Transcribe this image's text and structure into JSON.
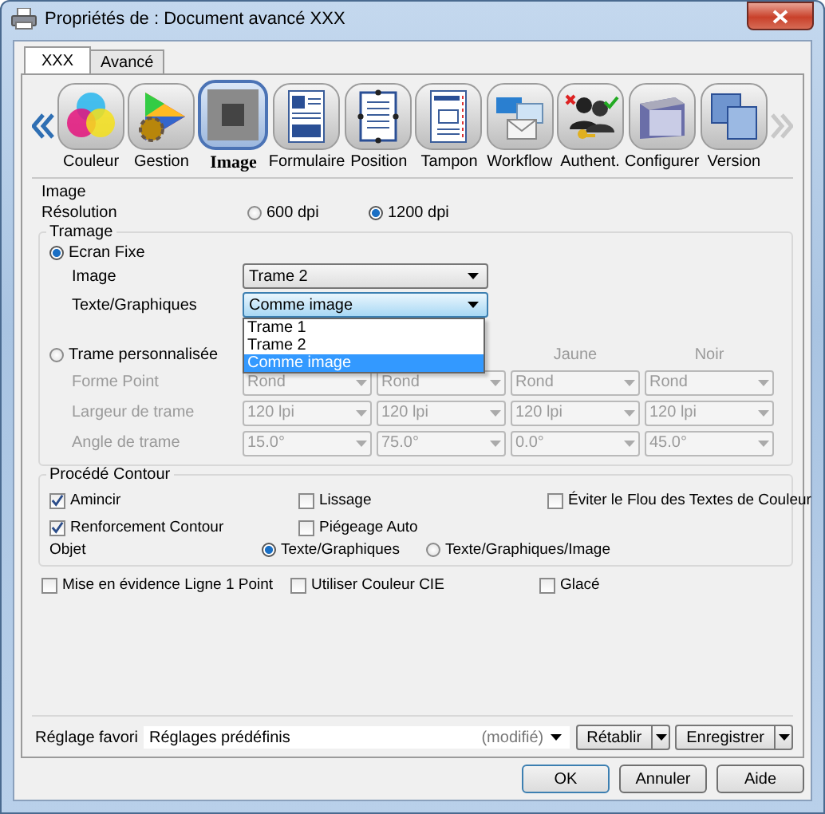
{
  "window": {
    "title": "Propriétés de : Document avancé XXX"
  },
  "tabs": [
    {
      "label": "XXX",
      "selected": true
    },
    {
      "label": "Avancé",
      "selected": false
    }
  ],
  "toolbar": {
    "items": [
      {
        "label": "Couleur",
        "kind": "color",
        "selected": false
      },
      {
        "label": "Gestion",
        "kind": "gamut",
        "selected": false
      },
      {
        "label": "Image",
        "kind": "image",
        "selected": true
      },
      {
        "label": "Formulaire",
        "kind": "form",
        "selected": false
      },
      {
        "label": "Position",
        "kind": "position",
        "selected": false
      },
      {
        "label": "Tampon",
        "kind": "stamp",
        "selected": false
      },
      {
        "label": "Workflow",
        "kind": "workflow",
        "selected": false
      },
      {
        "label": "Authent.",
        "kind": "auth",
        "selected": false
      },
      {
        "label": "Configurer",
        "kind": "config",
        "selected": false
      },
      {
        "label": "Version",
        "kind": "version",
        "selected": false
      }
    ]
  },
  "image_group": {
    "title": "Image",
    "resolution": {
      "label": "Résolution",
      "options": [
        {
          "label": "600 dpi",
          "selected": false
        },
        {
          "label": "1200 dpi",
          "selected": true
        }
      ]
    }
  },
  "tramage": {
    "title": "Tramage",
    "fixed": {
      "label": "Ecran Fixe",
      "selected": true,
      "fields": [
        {
          "label": "Image",
          "value": "Trame 2",
          "open": false
        },
        {
          "label": "Texte/Graphiques",
          "value": "Comme image",
          "open": true,
          "options": [
            {
              "label": "Trame 1",
              "selected": false
            },
            {
              "label": "Trame 2",
              "selected": false
            },
            {
              "label": "Comme image",
              "selected": true
            }
          ]
        }
      ]
    },
    "custom": {
      "label": "Trame personnalisée",
      "selected": false,
      "disabled": true,
      "columns": [
        "Jaune",
        "Noir"
      ],
      "rows": [
        {
          "label": "Forme Point",
          "values": [
            "Rond",
            "Rond",
            "Rond",
            "Rond"
          ]
        },
        {
          "label": "Largeur de trame",
          "values": [
            "120 lpi",
            "120 lpi",
            "120 lpi",
            "120 lpi"
          ]
        },
        {
          "label": "Angle de trame",
          "values": [
            "15.0°",
            "75.0°",
            "0.0°",
            "45.0°"
          ]
        }
      ]
    }
  },
  "contour": {
    "title": "Procédé Contour",
    "checks": [
      {
        "label": "Amincir",
        "checked": true
      },
      {
        "label": "Lissage",
        "checked": false
      },
      {
        "label": "Éviter le Flou des Textes de Couleur",
        "checked": false
      },
      {
        "label": "Renforcement Contour",
        "checked": true
      },
      {
        "label": "Piégeage Auto",
        "checked": false
      }
    ],
    "object": {
      "label": "Objet",
      "options": [
        {
          "label": "Texte/Graphiques",
          "selected": true
        },
        {
          "label": "Texte/Graphiques/Image",
          "selected": false
        }
      ]
    }
  },
  "extras": [
    {
      "label": "Mise en évidence Ligne 1 Point",
      "checked": false
    },
    {
      "label": "Utiliser Couleur CIE",
      "checked": false
    },
    {
      "label": "Glacé",
      "checked": false
    }
  ],
  "favorite": {
    "label": "Réglage favori",
    "value": "Réglages prédéfinis",
    "note": "(modifié)",
    "buttons": [
      "Rétablir",
      "Enregistrer"
    ]
  },
  "buttons": [
    "OK",
    "Annuler",
    "Aide"
  ]
}
